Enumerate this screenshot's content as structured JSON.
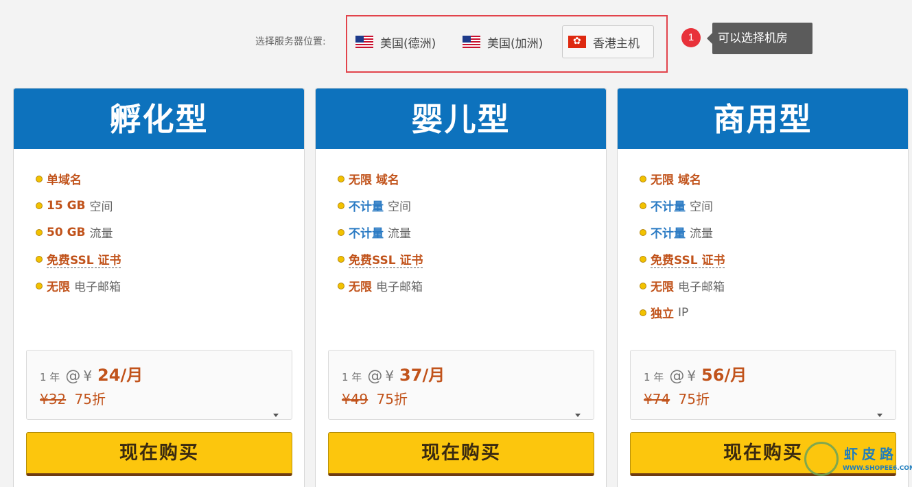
{
  "location": {
    "label": "选择服务器位置:",
    "options": [
      {
        "label": "美国(德洲)",
        "flag": "us-flag-icon",
        "selected": false
      },
      {
        "label": "美国(加洲)",
        "flag": "us-flag-icon",
        "selected": false
      },
      {
        "label": "香港主机",
        "flag": "hk-flag-icon",
        "selected": true
      }
    ]
  },
  "tooltip": {
    "number": "1",
    "text": "可以选择机房"
  },
  "plans": [
    {
      "title": "孵化型",
      "features": [
        {
          "em": "单域名",
          "rest": "",
          "em_color": "orange"
        },
        {
          "em": "15 GB",
          "rest": "空间",
          "em_color": "orange"
        },
        {
          "em": "50 GB",
          "rest": "流量",
          "em_color": "orange"
        },
        {
          "em": "免费SSL 证书",
          "rest": "",
          "em_color": "ssl"
        },
        {
          "em": "无限",
          "rest": "电子邮箱",
          "em_color": "orange"
        }
      ],
      "price": {
        "term": "1 年",
        "at": "@",
        "yen": "¥",
        "amount": "24/月",
        "original": "¥32",
        "discount": "75折"
      },
      "buy_label": "现在购买"
    },
    {
      "title": "婴儿型",
      "features": [
        {
          "em": "无限 域名",
          "rest": "",
          "em_color": "orange"
        },
        {
          "em": "不计量",
          "rest": "空间",
          "em_color": "blue"
        },
        {
          "em": "不计量",
          "rest": "流量",
          "em_color": "blue"
        },
        {
          "em": "免费SSL 证书",
          "rest": "",
          "em_color": "ssl"
        },
        {
          "em": "无限",
          "rest": "电子邮箱",
          "em_color": "orange"
        }
      ],
      "price": {
        "term": "1 年",
        "at": "@",
        "yen": "¥",
        "amount": "37/月",
        "original": "¥49",
        "discount": "75折"
      },
      "buy_label": "现在购买"
    },
    {
      "title": "商用型",
      "features": [
        {
          "em": "无限 域名",
          "rest": "",
          "em_color": "orange"
        },
        {
          "em": "不计量",
          "rest": "空间",
          "em_color": "blue"
        },
        {
          "em": "不计量",
          "rest": "流量",
          "em_color": "blue"
        },
        {
          "em": "免费SSL 证书",
          "rest": "",
          "em_color": "ssl"
        },
        {
          "em": "无限",
          "rest": "电子邮箱",
          "em_color": "orange"
        },
        {
          "em": "独立",
          "rest": "IP",
          "em_color": "orange"
        }
      ],
      "price": {
        "term": "1 年",
        "at": "@",
        "yen": "¥",
        "amount": "56/月",
        "original": "¥74",
        "discount": "75折"
      },
      "buy_label": "现在购买"
    }
  ],
  "watermark": {
    "name": "虾皮路",
    "url": "WWW.SHOPEE6.COM"
  },
  "colors": {
    "header_blue": "#0d72bd",
    "button_yellow": "#fcc60d",
    "accent_orange": "#c1531b",
    "accent_blue": "#2b7bc4",
    "highlight_red": "#e2434b"
  }
}
